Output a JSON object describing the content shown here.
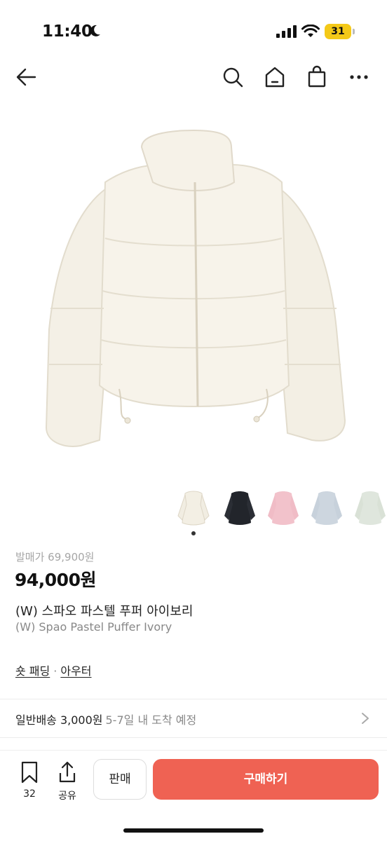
{
  "status_bar": {
    "time": "11:40",
    "battery": "31",
    "icons": [
      "moon-icon",
      "signal-icon",
      "wifi-icon",
      "battery-icon"
    ]
  },
  "nav": {
    "icons": [
      "back-arrow-icon",
      "search-icon",
      "home-icon",
      "shopping-bag-icon",
      "more-icon"
    ]
  },
  "product": {
    "release_price": "발매가 69,900원",
    "price": "94,000원",
    "name_ko": "(W) 스파오 파스텔 푸퍼 아이보리",
    "name_en": "(W) Spao Pastel Puffer Ivory",
    "categories": [
      "숏 패딩",
      "아우터"
    ],
    "category_separator": "·",
    "image_icon": "puffer-jacket-image"
  },
  "swatches": [
    {
      "color": "#f3efe4"
    },
    {
      "color": "#22252b"
    },
    {
      "color": "#f2c2cb"
    },
    {
      "color": "#cdd6df"
    },
    {
      "color": "#dfe6dd"
    }
  ],
  "shipping": {
    "type": "일반배송 3,000원",
    "estimate": "5-7일 내 도착 예정"
  },
  "actions": {
    "bookmark_count": "32",
    "share_label": "공유",
    "sell_label": "판매",
    "buy_label": "구매하기"
  },
  "colors": {
    "accent": "#ef6253",
    "muted_text": "#888888"
  }
}
